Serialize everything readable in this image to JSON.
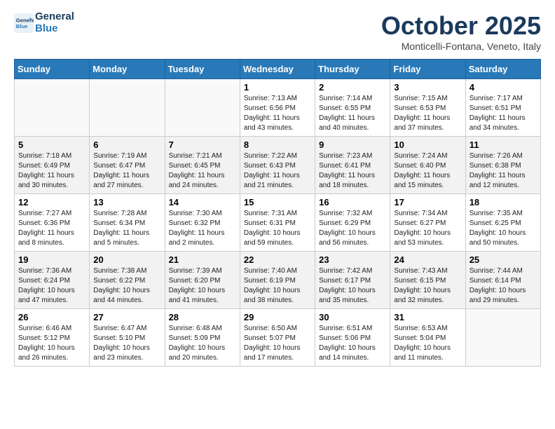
{
  "header": {
    "logo_line1": "General",
    "logo_line2": "Blue",
    "month_title": "October 2025",
    "location": "Monticelli-Fontana, Veneto, Italy"
  },
  "weekdays": [
    "Sunday",
    "Monday",
    "Tuesday",
    "Wednesday",
    "Thursday",
    "Friday",
    "Saturday"
  ],
  "weeks": [
    [
      {
        "day": "",
        "info": ""
      },
      {
        "day": "",
        "info": ""
      },
      {
        "day": "",
        "info": ""
      },
      {
        "day": "1",
        "info": "Sunrise: 7:13 AM\nSunset: 6:56 PM\nDaylight: 11 hours\nand 43 minutes."
      },
      {
        "day": "2",
        "info": "Sunrise: 7:14 AM\nSunset: 6:55 PM\nDaylight: 11 hours\nand 40 minutes."
      },
      {
        "day": "3",
        "info": "Sunrise: 7:15 AM\nSunset: 6:53 PM\nDaylight: 11 hours\nand 37 minutes."
      },
      {
        "day": "4",
        "info": "Sunrise: 7:17 AM\nSunset: 6:51 PM\nDaylight: 11 hours\nand 34 minutes."
      }
    ],
    [
      {
        "day": "5",
        "info": "Sunrise: 7:18 AM\nSunset: 6:49 PM\nDaylight: 11 hours\nand 30 minutes."
      },
      {
        "day": "6",
        "info": "Sunrise: 7:19 AM\nSunset: 6:47 PM\nDaylight: 11 hours\nand 27 minutes."
      },
      {
        "day": "7",
        "info": "Sunrise: 7:21 AM\nSunset: 6:45 PM\nDaylight: 11 hours\nand 24 minutes."
      },
      {
        "day": "8",
        "info": "Sunrise: 7:22 AM\nSunset: 6:43 PM\nDaylight: 11 hours\nand 21 minutes."
      },
      {
        "day": "9",
        "info": "Sunrise: 7:23 AM\nSunset: 6:41 PM\nDaylight: 11 hours\nand 18 minutes."
      },
      {
        "day": "10",
        "info": "Sunrise: 7:24 AM\nSunset: 6:40 PM\nDaylight: 11 hours\nand 15 minutes."
      },
      {
        "day": "11",
        "info": "Sunrise: 7:26 AM\nSunset: 6:38 PM\nDaylight: 11 hours\nand 12 minutes."
      }
    ],
    [
      {
        "day": "12",
        "info": "Sunrise: 7:27 AM\nSunset: 6:36 PM\nDaylight: 11 hours\nand 8 minutes."
      },
      {
        "day": "13",
        "info": "Sunrise: 7:28 AM\nSunset: 6:34 PM\nDaylight: 11 hours\nand 5 minutes."
      },
      {
        "day": "14",
        "info": "Sunrise: 7:30 AM\nSunset: 6:32 PM\nDaylight: 11 hours\nand 2 minutes."
      },
      {
        "day": "15",
        "info": "Sunrise: 7:31 AM\nSunset: 6:31 PM\nDaylight: 10 hours\nand 59 minutes."
      },
      {
        "day": "16",
        "info": "Sunrise: 7:32 AM\nSunset: 6:29 PM\nDaylight: 10 hours\nand 56 minutes."
      },
      {
        "day": "17",
        "info": "Sunrise: 7:34 AM\nSunset: 6:27 PM\nDaylight: 10 hours\nand 53 minutes."
      },
      {
        "day": "18",
        "info": "Sunrise: 7:35 AM\nSunset: 6:25 PM\nDaylight: 10 hours\nand 50 minutes."
      }
    ],
    [
      {
        "day": "19",
        "info": "Sunrise: 7:36 AM\nSunset: 6:24 PM\nDaylight: 10 hours\nand 47 minutes."
      },
      {
        "day": "20",
        "info": "Sunrise: 7:38 AM\nSunset: 6:22 PM\nDaylight: 10 hours\nand 44 minutes."
      },
      {
        "day": "21",
        "info": "Sunrise: 7:39 AM\nSunset: 6:20 PM\nDaylight: 10 hours\nand 41 minutes."
      },
      {
        "day": "22",
        "info": "Sunrise: 7:40 AM\nSunset: 6:19 PM\nDaylight: 10 hours\nand 38 minutes."
      },
      {
        "day": "23",
        "info": "Sunrise: 7:42 AM\nSunset: 6:17 PM\nDaylight: 10 hours\nand 35 minutes."
      },
      {
        "day": "24",
        "info": "Sunrise: 7:43 AM\nSunset: 6:15 PM\nDaylight: 10 hours\nand 32 minutes."
      },
      {
        "day": "25",
        "info": "Sunrise: 7:44 AM\nSunset: 6:14 PM\nDaylight: 10 hours\nand 29 minutes."
      }
    ],
    [
      {
        "day": "26",
        "info": "Sunrise: 6:46 AM\nSunset: 5:12 PM\nDaylight: 10 hours\nand 26 minutes."
      },
      {
        "day": "27",
        "info": "Sunrise: 6:47 AM\nSunset: 5:10 PM\nDaylight: 10 hours\nand 23 minutes."
      },
      {
        "day": "28",
        "info": "Sunrise: 6:48 AM\nSunset: 5:09 PM\nDaylight: 10 hours\nand 20 minutes."
      },
      {
        "day": "29",
        "info": "Sunrise: 6:50 AM\nSunset: 5:07 PM\nDaylight: 10 hours\nand 17 minutes."
      },
      {
        "day": "30",
        "info": "Sunrise: 6:51 AM\nSunset: 5:06 PM\nDaylight: 10 hours\nand 14 minutes."
      },
      {
        "day": "31",
        "info": "Sunrise: 6:53 AM\nSunset: 5:04 PM\nDaylight: 10 hours\nand 11 minutes."
      },
      {
        "day": "",
        "info": ""
      }
    ]
  ]
}
